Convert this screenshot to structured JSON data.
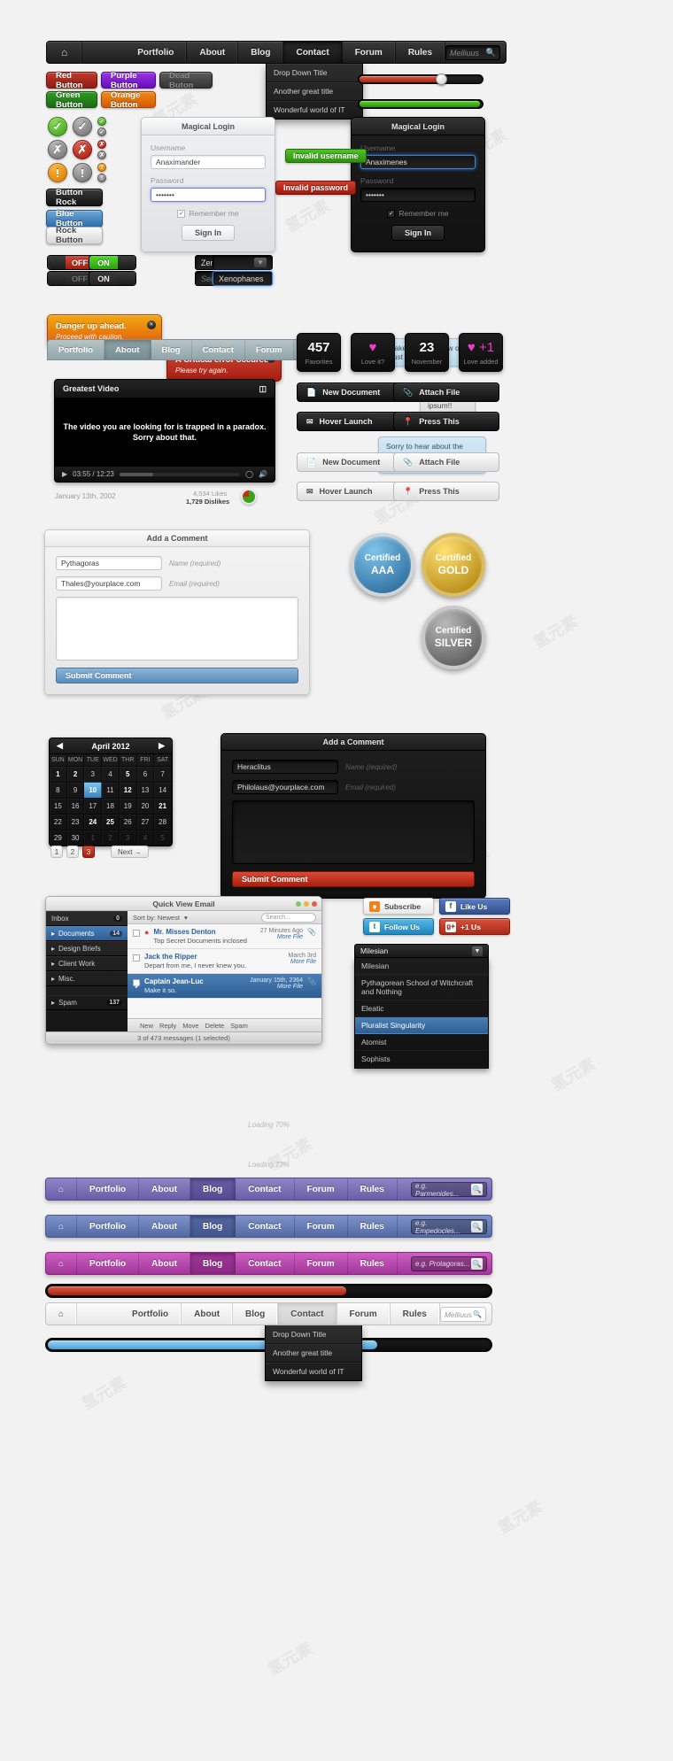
{
  "nav_dark": {
    "home_icon": "home-icon",
    "items": [
      "Portfolio",
      "About",
      "Blog",
      "Contact",
      "Forum",
      "Rules"
    ],
    "active": "Contact",
    "search_value": "Melliuus",
    "search_icon": "search-icon"
  },
  "dropdown": {
    "items": [
      "Drop Down Title",
      "Another great title",
      "Wonderful world of IT"
    ]
  },
  "buttons": {
    "red": "Red Button",
    "purple": "Purple Button",
    "dead": "Dead Buton",
    "green": "Green Button",
    "orange": "Orange Button",
    "rock": "Button Rock",
    "blue": "Blue Button",
    "rock_light": "Rock Button"
  },
  "icon_buttons": {
    "check": "✓",
    "cross": "✕",
    "bang": "!"
  },
  "toggles": {
    "off_active": "OFF",
    "on_active": "ON",
    "off_dead": "OFF",
    "on_dead": "ON"
  },
  "dark_inputs": {
    "stepper_value": "Zeno",
    "search_placeholder": "Search...",
    "focused_value": "Xenophanes"
  },
  "sliders": {
    "red_pct": 72,
    "green_pct": 100
  },
  "login_light": {
    "title": "Magical Login",
    "username_label": "Username",
    "username_value": "Anaximander",
    "password_label": "Password",
    "password_value": "•••••••",
    "remember": "Remember me",
    "submit": "Sign In"
  },
  "login_dark": {
    "title": "Magical Login",
    "username_label": "Username",
    "username_value": "Anaximenes",
    "password_label": "Password",
    "password_value": "•••••••",
    "remember": "Remember me",
    "submit": "Sign In"
  },
  "flags": {
    "invalid_username": "Invalid username",
    "invalid_password": "Invalid password"
  },
  "alerts": [
    {
      "title": "Danger up ahead.",
      "sub": "Proceed with caution.",
      "kind": "warning"
    },
    {
      "title": "A Critical error occured.",
      "sub": "Please try again.",
      "kind": "error"
    }
  ],
  "grey_tabs": {
    "items": [
      "Portfolio",
      "About",
      "Blog",
      "Contact",
      "Forum",
      "Rules"
    ],
    "active": "About"
  },
  "video": {
    "title": "Greatest Video",
    "line1": "The video you are looking for is trapped in a paradox.",
    "line2": "Sorry about that.",
    "time": "03:55 / 12:23",
    "date": "January 13th, 2002",
    "likes": "4,534 Likes",
    "dislikes": "1,729 Dislikes"
  },
  "bubbles": [
    "It takes one to know one. Trust me.",
    "Lorem ipsum!!",
    "Sorry to hear about the accident. I hope your loremitus goes away."
  ],
  "counters": [
    {
      "value": "457",
      "caption": "Favorites",
      "type": "number"
    },
    {
      "value": "♥",
      "caption": "Love it?",
      "type": "heart"
    },
    {
      "value": "23",
      "caption": "November",
      "type": "number"
    },
    {
      "value": "♥ +1",
      "caption": "Love added",
      "type": "heart"
    }
  ],
  "action_buttons_dark": [
    {
      "label": "New Document",
      "icon": "document-icon"
    },
    {
      "label": "Attach File",
      "icon": "paperclip-icon"
    },
    {
      "label": "Hover Launch",
      "icon": "envelope-icon"
    },
    {
      "label": "Press This",
      "icon": "pin-icon"
    }
  ],
  "action_buttons_light": [
    {
      "label": "New Document",
      "icon": "document-icon"
    },
    {
      "label": "Attach File",
      "icon": "paperclip-icon"
    },
    {
      "label": "Hover Launch",
      "icon": "envelope-icon"
    },
    {
      "label": "Press This",
      "icon": "pin-icon"
    }
  ],
  "comment_light": {
    "title": "Add a Comment",
    "name_value": "Pythagoras",
    "name_hint": "Name (required)",
    "email_value": "Thales@yourplace.com",
    "email_hint": "Email (required)",
    "submit": "Submit Comment"
  },
  "comment_dark": {
    "title": "Add a Comment",
    "name_value": "Heraclitus",
    "name_hint": "Name (required)",
    "email_value": "Philolaus@yourplace.com",
    "email_hint": "Email (required)",
    "submit": "Submit Comment"
  },
  "badges": [
    {
      "l1": "Certified",
      "l2": "AAA",
      "kind": "aaa"
    },
    {
      "l1": "Certified",
      "l2": "GOLD",
      "kind": "gold"
    },
    {
      "l1": "Certified",
      "l2": "SILVER",
      "kind": "silver"
    }
  ],
  "calendar": {
    "month": "April 2012",
    "prev_icon": "chevron-left-icon",
    "next_icon": "chevron-right-icon",
    "daynames": [
      "SUN",
      "MON",
      "TUE",
      "WED",
      "THR",
      "FRI",
      "SAT"
    ],
    "cells": [
      {
        "d": "1",
        "s": "b"
      },
      {
        "d": "2",
        "s": "b"
      },
      {
        "d": "3",
        "s": ""
      },
      {
        "d": "4",
        "s": ""
      },
      {
        "d": "5",
        "s": "b"
      },
      {
        "d": "6",
        "s": ""
      },
      {
        "d": "7",
        "s": ""
      },
      {
        "d": "8",
        "s": ""
      },
      {
        "d": "9",
        "s": ""
      },
      {
        "d": "10",
        "s": "sel"
      },
      {
        "d": "11",
        "s": ""
      },
      {
        "d": "12",
        "s": "b"
      },
      {
        "d": "13",
        "s": ""
      },
      {
        "d": "14",
        "s": ""
      },
      {
        "d": "15",
        "s": ""
      },
      {
        "d": "16",
        "s": ""
      },
      {
        "d": "17",
        "s": ""
      },
      {
        "d": "18",
        "s": ""
      },
      {
        "d": "19",
        "s": ""
      },
      {
        "d": "20",
        "s": ""
      },
      {
        "d": "21",
        "s": "b"
      },
      {
        "d": "22",
        "s": ""
      },
      {
        "d": "23",
        "s": ""
      },
      {
        "d": "24",
        "s": "b"
      },
      {
        "d": "25",
        "s": "b"
      },
      {
        "d": "26",
        "s": ""
      },
      {
        "d": "27",
        "s": ""
      },
      {
        "d": "28",
        "s": ""
      },
      {
        "d": "29",
        "s": ""
      },
      {
        "d": "30",
        "s": ""
      },
      {
        "d": "1",
        "s": "d"
      },
      {
        "d": "2",
        "s": "d"
      },
      {
        "d": "3",
        "s": "d"
      },
      {
        "d": "4",
        "s": "d"
      },
      {
        "d": "5",
        "s": "d"
      }
    ]
  },
  "pager": {
    "pages": [
      "1",
      "2",
      "3"
    ],
    "active": "3",
    "next": "Next →"
  },
  "email": {
    "title": "Quick View Email",
    "folders": [
      {
        "label": "Inbox",
        "count": "0",
        "state": "header"
      },
      {
        "label": "Documents",
        "count": "14",
        "state": "active"
      },
      {
        "label": "Design Briefs",
        "count": "",
        "state": ""
      },
      {
        "label": "Client Work",
        "count": "",
        "state": ""
      },
      {
        "label": "Misc.",
        "count": "",
        "state": ""
      },
      {
        "label": "Spam",
        "count": "137",
        "state": ""
      }
    ],
    "sortby": "Sort by: Newest",
    "search_placeholder": "Search...",
    "messages": [
      {
        "name": "Mr. Misses Denton",
        "subject": "Top Secret Documents inclosed",
        "time": "27 Minutes Ago",
        "action": "More File",
        "selected": false,
        "attach": true
      },
      {
        "name": "Jack the Ripper",
        "subject": "Depart from me, I never knew you.",
        "time": "March 3rd",
        "action": "More File",
        "selected": false,
        "attach": false
      },
      {
        "name": "Captain Jean-Luc",
        "subject": "Make it so.",
        "time": "January 15th, 2364",
        "action": "More File",
        "selected": true,
        "attach": true
      }
    ],
    "toolbar": [
      "New",
      "Reply",
      "Move",
      "Delete",
      "Spam"
    ],
    "status": "3 of 473 messages (1 selected)"
  },
  "social": [
    {
      "label": "Subscribe",
      "icon": "rss-icon",
      "kind": "rss"
    },
    {
      "label": "Like Us",
      "icon": "facebook-icon",
      "kind": "fb"
    },
    {
      "label": "Follow Us",
      "icon": "twitter-icon",
      "kind": "tw"
    },
    {
      "label": "+1 Us",
      "icon": "googleplus-icon",
      "kind": "gp"
    }
  ],
  "select": {
    "selected": "Milesian",
    "arrow_icon": "chevron-down-icon",
    "options": [
      "Milesian",
      "Pythagorean School of Witchcraft and Nothing",
      "Eleatic",
      "Pluralist Singularity",
      "Atomist",
      "Sophists"
    ],
    "highlighted": "Pluralist Singularity"
  },
  "progress": [
    {
      "pct": 70,
      "color": "#c83420",
      "label": "Loading 70%"
    },
    {
      "pct": 73,
      "color": "#6fb8e0",
      "label": "Loading 73%"
    }
  ],
  "nav_purple": {
    "home_icon": "home-icon",
    "items": [
      "Portfolio",
      "About",
      "Blog",
      "Contact",
      "Forum",
      "Rules"
    ],
    "active": "Blog",
    "search_placeholder": "e.g. Parmenides...",
    "search_icon": "search-icon"
  },
  "nav_blue": {
    "home_icon": "home-icon",
    "items": [
      "Portfolio",
      "About",
      "Blog",
      "Contact",
      "Forum",
      "Rules"
    ],
    "active": "Blog",
    "search_placeholder": "e.g. Empedocles...",
    "search_icon": "search-icon"
  },
  "nav_pink": {
    "home_icon": "home-icon",
    "items": [
      "Portfolio",
      "About",
      "Blog",
      "Contact",
      "Forum",
      "Rules"
    ],
    "active": "Blog",
    "search_placeholder": "e.g. Protagoras...",
    "search_icon": "search-icon"
  },
  "nav_light": {
    "home_icon": "home-icon",
    "items": [
      "Portfolio",
      "About",
      "Blog",
      "Contact",
      "Forum",
      "Rules"
    ],
    "active": "Contact",
    "search_value": "Melliuus",
    "search_icon": "search-icon"
  },
  "dropdown_bottom": {
    "items": [
      "Drop Down Title",
      "Another great title",
      "Wonderful world of IT"
    ]
  }
}
